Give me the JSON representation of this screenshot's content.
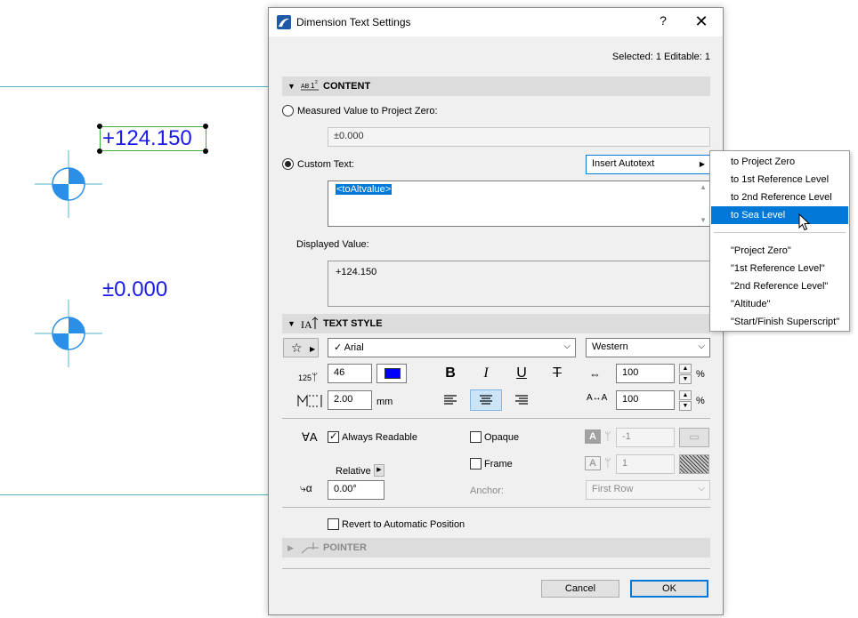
{
  "canvas": {
    "elevation_top": "+124.150",
    "elevation_bottom": "±0.000"
  },
  "dialog": {
    "title": "Dimension Text Settings",
    "help": "?",
    "close": "✕",
    "selected_info": "Selected: 1 Editable: 1",
    "content_section": {
      "title": "CONTENT",
      "measured_label": "Measured Value to Project Zero:",
      "measured_value": "±0.000",
      "custom_label": "Custom Text:",
      "insert_autotext": "Insert Autotext",
      "custom_text": "<toAltvalue>",
      "displayed_label": "Displayed Value:",
      "displayed_value": "+124.150"
    },
    "text_style_section": {
      "title": "TEXT STYLE",
      "font": "Arial",
      "font_check": "✓",
      "script": "Western",
      "size_value": "46",
      "size_icon_text": "125",
      "leading_value": "2.00",
      "leading_unit": "mm",
      "width_value": "100",
      "width_unit": "%",
      "spacing_value": "100",
      "spacing_unit": "%",
      "bold": "B",
      "italic": "I",
      "underline": "U",
      "strike": "T"
    },
    "options": {
      "always_readable": "Always Readable",
      "opaque": "Opaque",
      "frame": "Frame",
      "relative": "Relative",
      "angle_value": "0.00°",
      "anchor_label": "Anchor:",
      "anchor_value": "First Row",
      "pen1_value": "-1",
      "pen2_value": "1",
      "revert_label": "Revert to Automatic Position"
    },
    "pointer_section": {
      "title": "POINTER"
    },
    "buttons": {
      "cancel": "Cancel",
      "ok": "OK"
    }
  },
  "autotext_menu": {
    "items": [
      "to Project Zero",
      "to 1st Reference Level",
      "to 2nd Reference Level",
      "to Sea Level"
    ],
    "items2": [
      "\"Project Zero\"",
      "\"1st Reference Level\"",
      "\"2nd Reference Level\"",
      "\"Altitude\"",
      "\"Start/Finish Superscript\""
    ]
  },
  "colors": {
    "accent": "#0078d7",
    "elevation_text": "#1a1ae8",
    "marker": "#2b8fe8",
    "guide_line": "#4fb6c4"
  }
}
